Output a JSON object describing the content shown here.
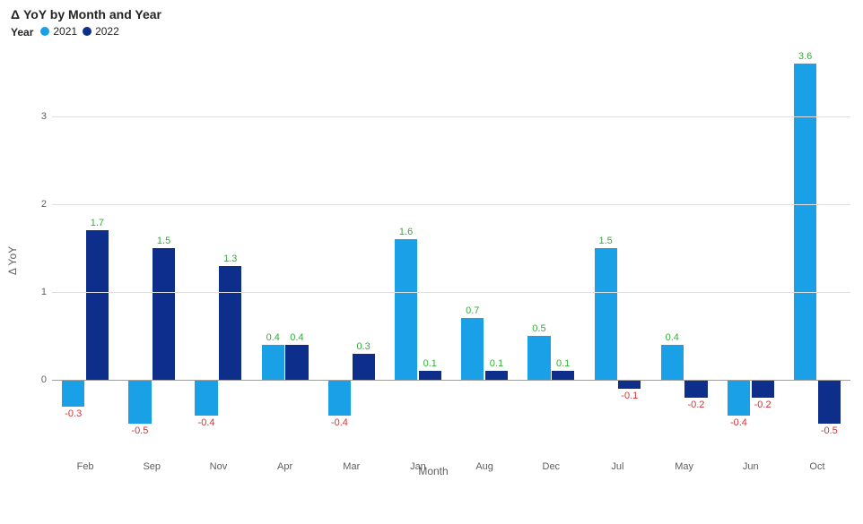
{
  "title": "Δ YoY by Month and Year",
  "legend": {
    "label": "Year",
    "items": [
      {
        "name": "2021",
        "color": "#1aa0e6"
      },
      {
        "name": "2022",
        "color": "#0d2e8a"
      }
    ]
  },
  "axes": {
    "ylabel": "Δ YoY",
    "xlabel": "Month",
    "yticks": [
      0,
      1,
      2,
      3
    ]
  },
  "colors": {
    "positiveLabel": "#2eb135",
    "negativeLabel": "#d13438"
  },
  "chart_data": {
    "type": "bar",
    "title": "Δ YoY by Month and Year",
    "xlabel": "Month",
    "ylabel": "Δ YoY",
    "ylim": [
      -0.7,
      3.8
    ],
    "categories": [
      "Feb",
      "Sep",
      "Nov",
      "Apr",
      "Mar",
      "Jan",
      "Aug",
      "Dec",
      "Jul",
      "May",
      "Jun",
      "Oct"
    ],
    "series": [
      {
        "name": "2021",
        "color": "#1aa0e6",
        "values": [
          -0.3,
          -0.5,
          -0.4,
          0.4,
          -0.4,
          1.6,
          0.7,
          0.5,
          1.5,
          0.4,
          -0.4,
          3.6
        ]
      },
      {
        "name": "2022",
        "color": "#0d2e8a",
        "values": [
          1.7,
          1.5,
          1.3,
          0.4,
          0.3,
          0.1,
          0.1,
          0.1,
          -0.1,
          -0.2,
          -0.2,
          -0.5
        ]
      }
    ]
  }
}
